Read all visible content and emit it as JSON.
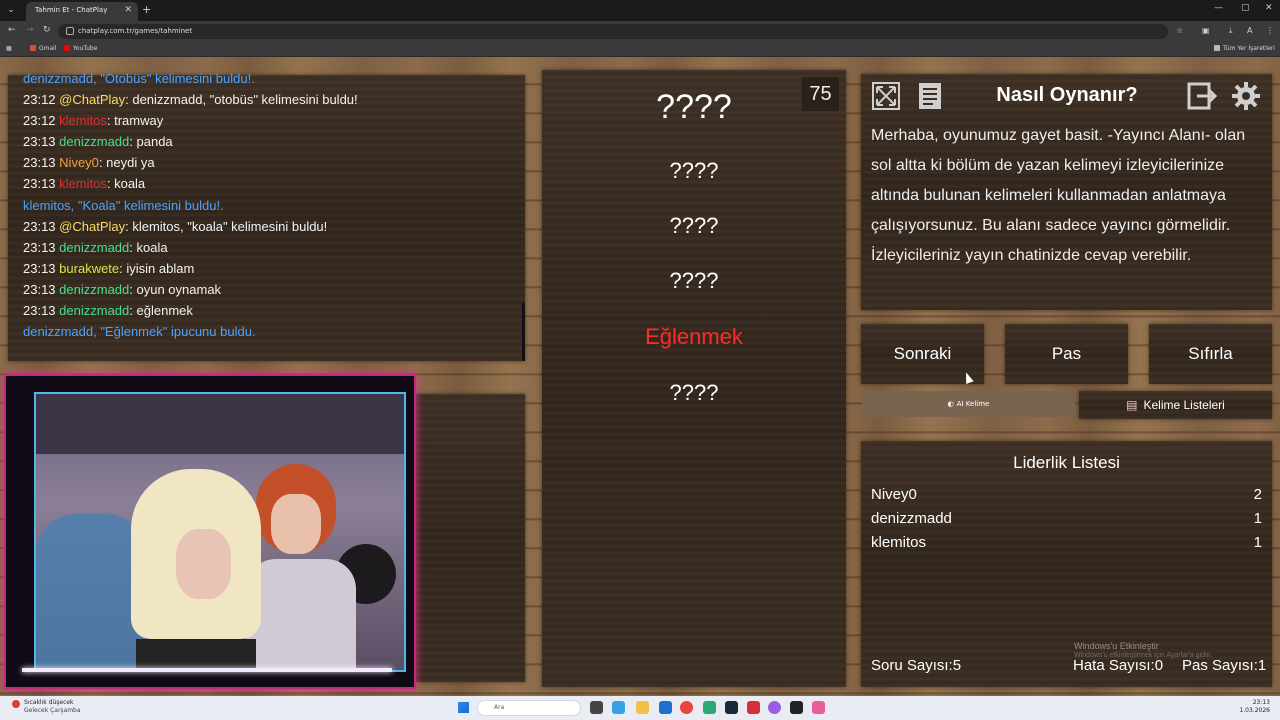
{
  "browser": {
    "tab_title": "Tahmin Et - ChatPlay",
    "url": "chatplay.com.tr/games/tahminet",
    "bookmarks": [
      "Gmail",
      "YouTube"
    ],
    "bookmarks_right": "Tüm Yer İşaretleri"
  },
  "chat": {
    "lines": [
      {
        "time": "",
        "user": "",
        "text": "denizzmadd, \"Otobüs\" kelimesini buldu!.",
        "sys": true
      },
      {
        "time": "23:12",
        "user": "@ChatPlay",
        "user_color": "#ffd966",
        "text": ": denizzmadd, \"otobüs\" kelimesini buldu!"
      },
      {
        "time": "23:12",
        "user": "klemitos",
        "user_color": "#e0302e",
        "text": ": tramway"
      },
      {
        "time": "23:13",
        "user": "denizzmadd",
        "user_color": "#43e08a",
        "text": ": panda"
      },
      {
        "time": "23:13",
        "user": "Nivey0",
        "user_color": "#f2a23a",
        "text": ": neydi ya"
      },
      {
        "time": "23:13",
        "user": "klemitos",
        "user_color": "#e0302e",
        "text": ": koala"
      },
      {
        "time": "",
        "user": "",
        "text": "klemitos, \"Koala\" kelimesini buldu!.",
        "sys": true
      },
      {
        "time": "23:13",
        "user": "@ChatPlay",
        "user_color": "#ffd966",
        "text": ": klemitos, \"koala\" kelimesini buldu!"
      },
      {
        "time": "23:13",
        "user": "denizzmadd",
        "user_color": "#43e08a",
        "text": ": koala"
      },
      {
        "time": "23:13",
        "user": "burakwete",
        "user_color": "#d4e64a",
        "text": ": iyisin ablam"
      },
      {
        "time": "23:13",
        "user": "denizzmadd",
        "user_color": "#43e08a",
        "text": ": oyun oynamak"
      },
      {
        "time": "23:13",
        "user": "denizzmadd",
        "user_color": "#43e08a",
        "text": ": eğlenmek"
      },
      {
        "time": "",
        "user": "",
        "text": "denizzmadd, \"Eğlenmek\" ipucunu buldu.",
        "sys": true
      }
    ]
  },
  "game": {
    "timer": "75",
    "words": [
      {
        "text": "????",
        "hit": false,
        "size": "big"
      },
      {
        "text": "????",
        "hit": false
      },
      {
        "text": "????",
        "hit": false
      },
      {
        "text": "????",
        "hit": false
      },
      {
        "text": "Eğlenmek",
        "hit": true
      },
      {
        "text": "????",
        "hit": false
      }
    ]
  },
  "howto": {
    "title": "Nasıl Oynanır?",
    "text": "Merhaba, oyunumuz gayet basit. -Yayıncı Alanı- olan sol altta ki bölüm de yazan kelimeyi izleyicilerinize altında bulunan kelimeleri kullanmadan anlatmaya çalışıyorsunuz. Bu alanı sadece yayıncı görmelidir. İzleyicileriniz yayın chatinizde cevap verebilir."
  },
  "controls": {
    "next": "Sonraki",
    "pass": "Pas",
    "reset": "Sıfırla",
    "ai_word": "AI Kelime",
    "word_lists": "Kelime Listeleri"
  },
  "leaderboard": {
    "title": "Liderlik Listesi",
    "rows": [
      {
        "name": "Nivey0",
        "score": "2"
      },
      {
        "name": "denizzmadd",
        "score": "1"
      },
      {
        "name": "klemitos",
        "score": "1"
      }
    ],
    "question_count": "Soru Sayısı:5",
    "error_count": "Hata Sayısı:0",
    "pass_count": "Pas Sayısı:1"
  },
  "watermark": {
    "line1": "Windows'u Etkinleştir",
    "line2": "Windows'u etkinleştirmek için Ayarlar'a gidin."
  },
  "taskbar": {
    "weather_title": "Sıcaklık düşecek",
    "weather_sub": "Gelecek Çarşamba",
    "search_placeholder": "Ara",
    "time": "23:13",
    "date": "1.03.2026"
  }
}
